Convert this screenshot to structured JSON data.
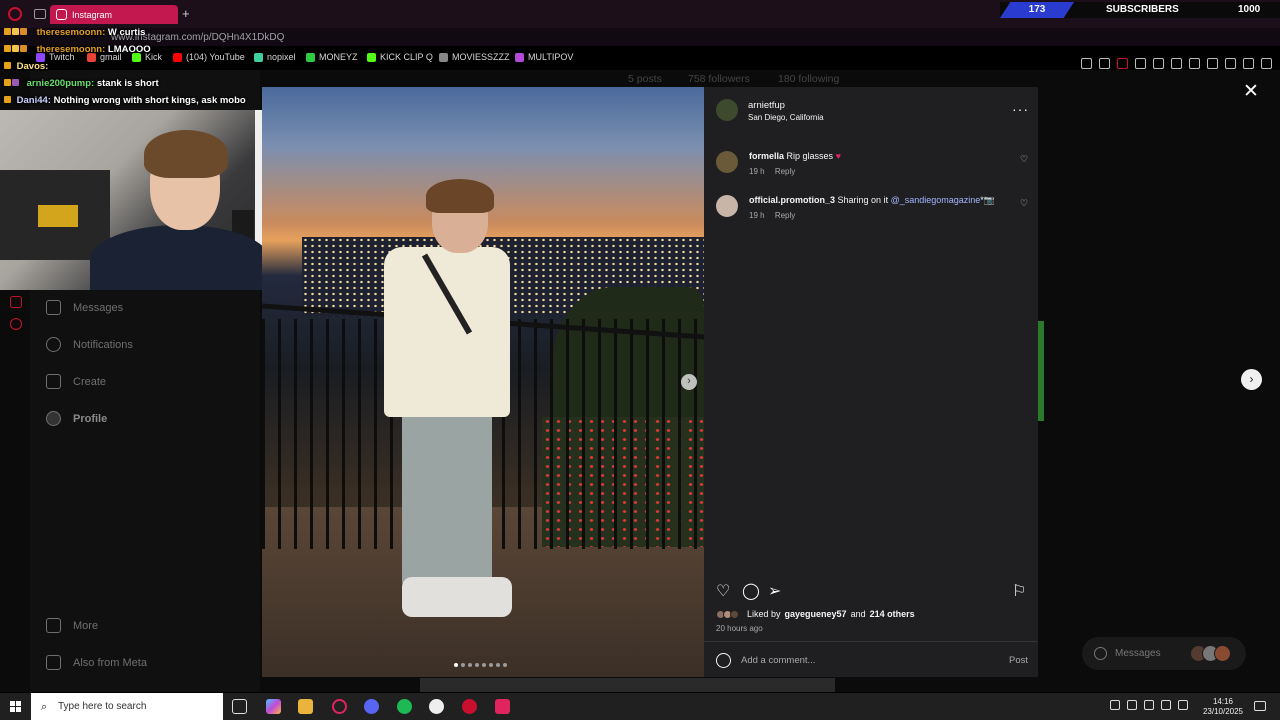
{
  "browser": {
    "tab_title": "Instagram",
    "url": "www.instagram.com/p/DQHn4X1DkDQ",
    "bookmarks": [
      {
        "label": "Twitch",
        "color": "#9146ff"
      },
      {
        "label": "gmail",
        "color": "#ea4335"
      },
      {
        "label": "Kick",
        "color": "#53fc18"
      },
      {
        "label": "(104) YouTube",
        "color": "#ff0000"
      },
      {
        "label": "nopixel",
        "color": "#3fd0a0"
      },
      {
        "label": "MONEYZ",
        "color": "#2ecc40"
      },
      {
        "label": "KICK CLIP Q",
        "color": "#53fc18"
      },
      {
        "label": "MOVIESSZZZ",
        "color": "#888888"
      },
      {
        "label": "MULTIPOV",
        "color": "#b44bd8"
      }
    ]
  },
  "stream_overlay": {
    "sub_count": "173",
    "sub_label": "SUBSCRIBERS",
    "sub_goal": "1000"
  },
  "chat": [
    {
      "user": "theresemoonn:",
      "message": "W curtis",
      "user_class": "u1"
    },
    {
      "user": "theresemoonn:",
      "message": "LMAOOO",
      "user_class": "u1"
    },
    {
      "user": "Davos:",
      "message": "",
      "user_class": "u4"
    },
    {
      "user": "arnie200pump:",
      "message": "stank is short",
      "user_class": "u3"
    },
    {
      "user": "Dani44:",
      "message": "Nothing wrong with short kings, ask mobo",
      "user_class": "u2"
    }
  ],
  "ig_sidebar": {
    "messages": "Messages",
    "notifications": "Notifications",
    "create": "Create",
    "profile": "Profile",
    "more": "More",
    "also_from_meta": "Also from Meta"
  },
  "profile_stats": {
    "posts": "5 posts",
    "followers": "758 followers",
    "following": "180 following"
  },
  "post": {
    "username": "arnietfup",
    "location": "San Diego, California",
    "more_label": "···",
    "comments": [
      {
        "user": "formella",
        "text": "Rip glasses",
        "emoji": "♥",
        "time": "19 h",
        "reply": "Reply"
      },
      {
        "user": "official.promotion_3",
        "text": "Sharing on it",
        "mention": "@_sandiegomagazine",
        "trailing": "*📷",
        "time": "19 h",
        "reply": "Reply"
      }
    ],
    "likes_prefix": "Liked by",
    "likes_user": "gayegueney57",
    "likes_and": "and",
    "likes_others": "214 others",
    "time_ago": "20 hours ago",
    "comment_placeholder": "Add a comment...",
    "post_button": "Post",
    "carousel_count": 8,
    "carousel_active": 0
  },
  "floating": {
    "messages_label": "Messages"
  },
  "taskbar": {
    "search_placeholder": "Type here to search",
    "time": "14:16",
    "date": "23/10/2025"
  },
  "colors": {
    "tab_accent": "#c3174f",
    "opera_red": "#c8102e",
    "sub_blue": "#2a3ccf",
    "mention_blue": "#a3b5ff",
    "panel_bg": "#1f1f21"
  }
}
